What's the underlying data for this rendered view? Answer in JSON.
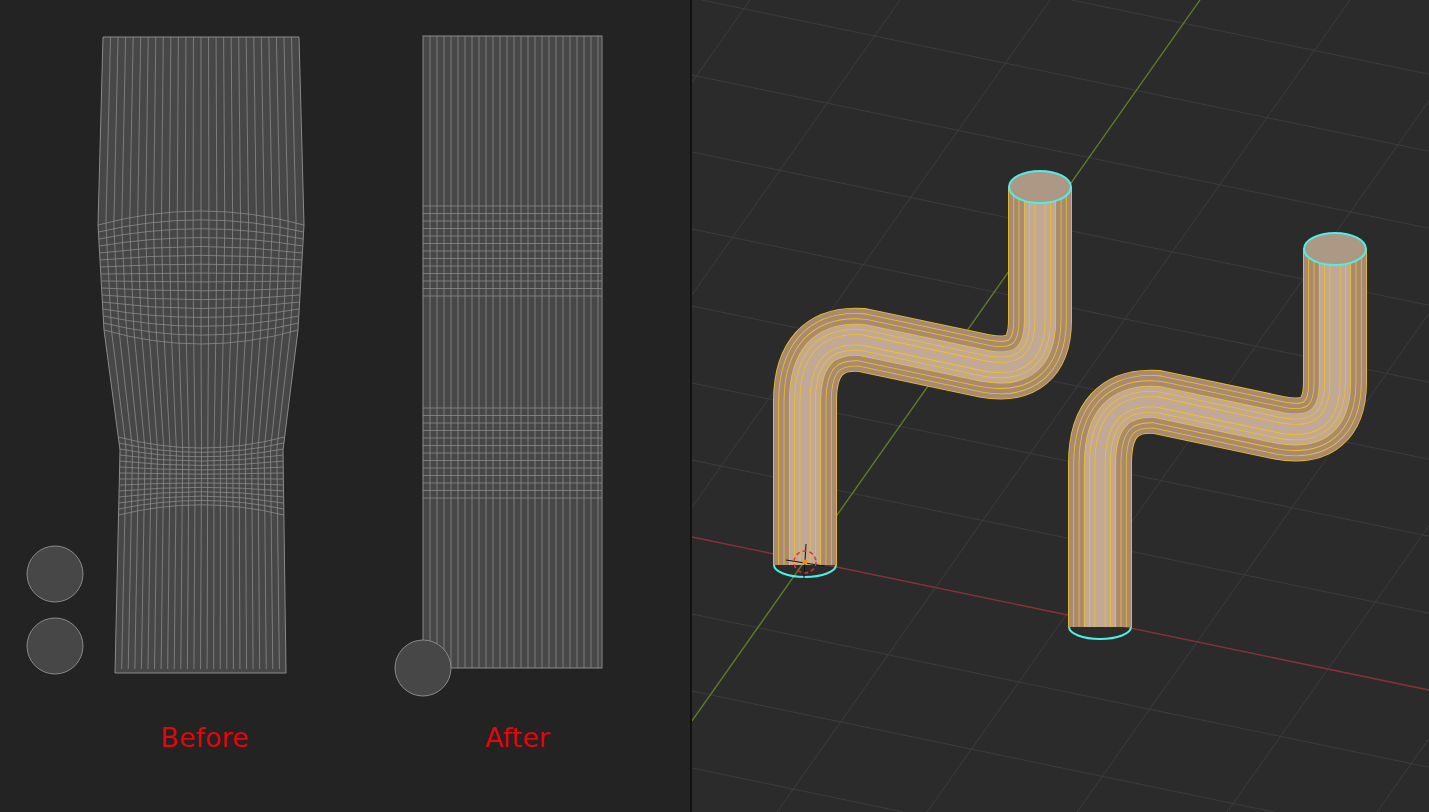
{
  "uv_editor": {
    "captions": [
      {
        "text": "Before"
      },
      {
        "text": "After"
      }
    ]
  }
}
